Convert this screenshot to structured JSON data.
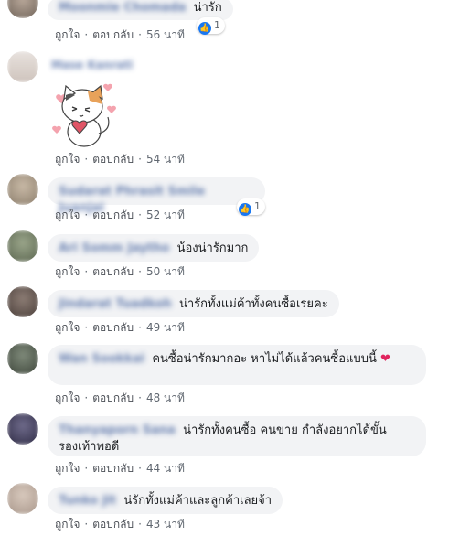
{
  "actions": {
    "like": "ถูกใจ",
    "reply": "ตอบกลับ",
    "separator": "·"
  },
  "comments": [
    {
      "name": "Moonmie Chomada",
      "text": "น่ารัก",
      "time": "56 นาที",
      "reactions": "1"
    },
    {
      "name": "Mase Kanrati",
      "text": "",
      "time": "54 นาที",
      "sticker": "cat-love-sticker"
    },
    {
      "name": "Sudarat Phrasit Smile Juanjai",
      "text": "",
      "time": "52 นาที",
      "reactions": "1"
    },
    {
      "name": "Ari Somm Jaytho",
      "text": "น้องน่ารักมาก",
      "time": "50 นาที"
    },
    {
      "name": "Jindarat Tuadkoh",
      "text": "น่ารักทั้งแม่ค้าทั้งคนซื้อเรยคะ",
      "time": "49 นาที"
    },
    {
      "name": "Wan Sookkai",
      "text": "คนซื้อน่ารักมากอะ หาไม่ได้แล้วคนซื้อแบบนี้",
      "time": "48 นาที"
    },
    {
      "name": "Thanyaporn Sana",
      "text": "น่ารักทั้งคนซื้อ คนขาย กำลังอยากได้ขั้นรองเท้าพอดี",
      "time": "44 นาที"
    },
    {
      "name": "Tunko Jit",
      "text": "น่รักทั้งแม่ค้าและลูกค้าเลยจ้า",
      "time": "43 นาที"
    }
  ],
  "colors": {
    "bubble": "#f2f3f5",
    "name": "#385898",
    "like": "#1877f2",
    "meta": "#606770"
  }
}
